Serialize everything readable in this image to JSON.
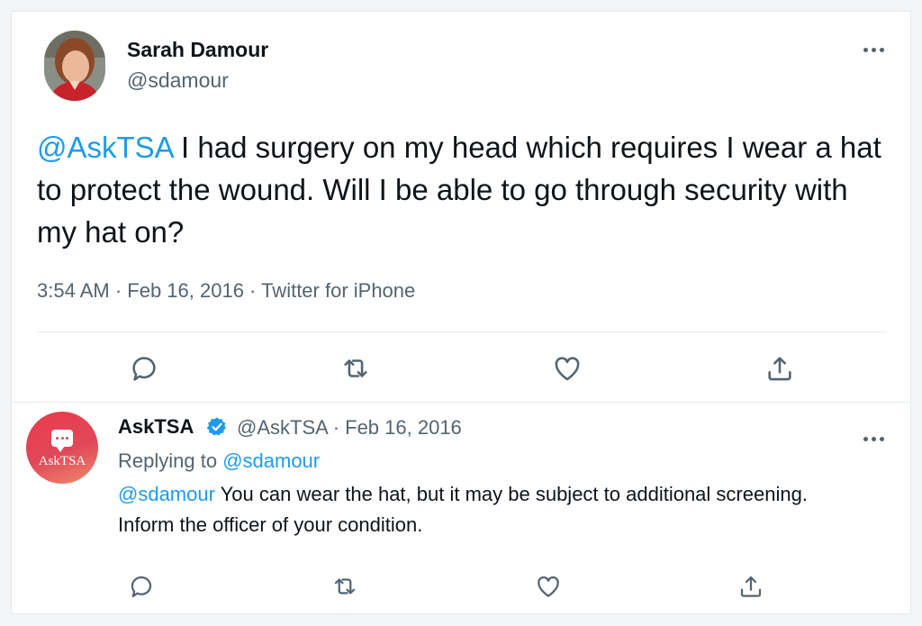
{
  "main_tweet": {
    "author_name": "Sarah Damour",
    "author_handle": "@sdamour",
    "mention": "@AskTSA",
    "text": " I had surgery on my head which requires I wear a hat to protect the wound. Will I be able to go through security with my hat on?",
    "meta": "3:54 AM · Feb 16, 2016 · Twitter for iPhone",
    "actions": [
      "reply-icon",
      "retweet-icon",
      "like-icon",
      "share-icon"
    ]
  },
  "reply_tweet": {
    "author_name": "AskTSA",
    "avatar_logo_prefix": "Ask",
    "avatar_logo_suffix": "TSA",
    "author_handle_date": "@AskTSA · Feb 16, 2016",
    "replying_prefix": "Replying to ",
    "replying_to": "@sdamour",
    "mention": "@sdamour",
    "text": " You can wear the hat, but it may be subject to additional screening. Inform the officer of your condition.",
    "actions": [
      "reply-icon",
      "retweet-icon",
      "like-icon",
      "share-icon"
    ]
  },
  "colors": {
    "link": "#1d9bf0",
    "secondary_text": "#536471",
    "verified": "#1d9bf0",
    "asktsa_avatar": "#e0485a"
  }
}
